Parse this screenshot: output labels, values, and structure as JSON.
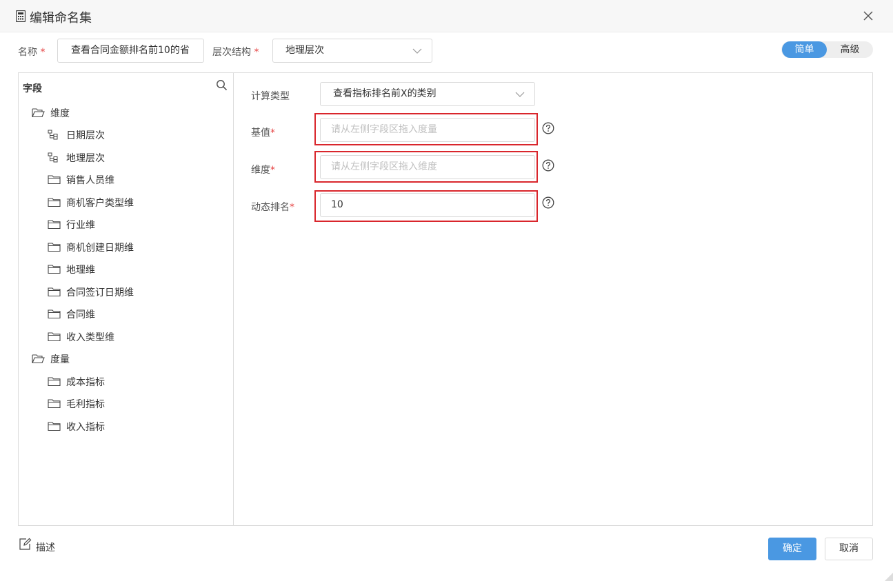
{
  "dialog": {
    "title": "编辑命名集",
    "icon": "calculator-icon"
  },
  "form": {
    "name_label": "名称",
    "name_value": "查看合同金额排名前10的省",
    "hierarchy_label": "层次结构",
    "hierarchy_value": "地理层次",
    "required_mark": "*"
  },
  "mode": {
    "simple": "简单",
    "advanced": "高级",
    "active": "simple"
  },
  "tree": {
    "header": "字段",
    "groups": [
      {
        "label": "维度",
        "items": [
          "日期层次",
          "地理层次",
          "销售人员维",
          "商机客户类型维",
          "行业维",
          "商机创建日期维",
          "地理维",
          "合同签订日期维",
          "合同维",
          "收入类型维"
        ]
      },
      {
        "label": "度量",
        "items": [
          "成本指标",
          "毛利指标",
          "收入指标"
        ]
      }
    ]
  },
  "fields": {
    "calc_type_label": "计算类型",
    "calc_type_value": "查看指标排名前X的类别",
    "base_label": "基值",
    "base_placeholder": "请从左侧字段区拖入度量",
    "dimension_label": "维度",
    "dimension_placeholder": "请从左侧字段区拖入维度",
    "rank_label": "动态排名",
    "rank_value": "10"
  },
  "footer": {
    "describe": "描述",
    "ok": "确定",
    "cancel": "取消"
  },
  "colors": {
    "primary": "#4a98e2",
    "highlight": "#d9262c",
    "required": "#e64545"
  }
}
